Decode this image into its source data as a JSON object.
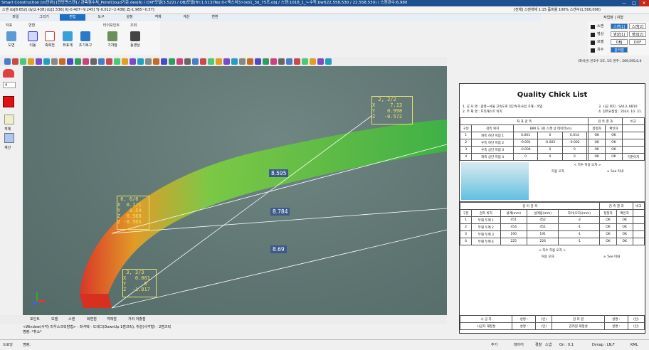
{
  "window": {
    "title": "Smart Construction [m단위] [전단면스캔] / 관측점수치_PointCloud기준.des(6) / DXF모델(3,522) / OBJ모델(Tri:1,513)Tex:0<텍스처3>)sb1_3d_75조.obj / 스캔:1018_1_ㄴ수득.bwf(22,558,530 / 22,558,530) / 스캔관수:6,980",
    "controls": [
      "—",
      "□",
      "✕"
    ]
  },
  "coords": "스캔 dx[8.652] dy[2.438] dz[2.536] X[-0.407~9.245] Y[-0.012~2.436] Z[-1.965~0.57]",
  "scale_info": "[전체] 스캔개체 1:15 줌비율 100% 스캔수(1,500,000)",
  "workmode": "작업창 | 지형",
  "menus": [
    "파일",
    "그리기",
    "편집",
    "도구",
    "설정",
    "객체",
    "계산",
    "변환"
  ],
  "active_menu": "편집",
  "ribbon": {
    "groups": [
      "작표",
      "변환",
      "타이포인트",
      "조회"
    ],
    "buttons": [
      "도면",
      "이동",
      "축회전",
      "좌표계",
      "초기복구",
      "기차참",
      "동영상"
    ]
  },
  "right_panel": {
    "rows": [
      {
        "label": "스캔",
        "b1": "스캔[1]",
        "b2": "스캔[2]"
      },
      {
        "label": "영상",
        "b1": "영상[1]",
        "b2": "영상[2]"
      },
      {
        "label": "모델",
        "b1": "OBJ",
        "b2": "DXF"
      },
      {
        "label": "치수",
        "b1": "관리점",
        "b2": ""
      }
    ],
    "caption": "(좌석선) 빈호수 5도, 5도 원주-, 569,595,0,0"
  },
  "annotations": [
    {
      "lines": "  2, 2/2\nX     7.13\nY    0.998\nZ   -0.572"
    },
    {
      "lines": " 6, 6/6\nX  0.1/1\nY   0.54\nZ  0.568\nZ -0.505"
    },
    {
      "lines": " 3, 3/3\nX   0.001\nY      0\nZ  -1.817"
    }
  ],
  "dimensions": [
    "8.595",
    "8.784",
    "8.69"
  ],
  "report": {
    "title": "Quality Chick List",
    "info_left": [
      "1. 공 사 명 : 광명~서울 고속도로 민간투자사업 기해 - 목업",
      "2. 부 재 명 : 프리캐스트 아치"
    ],
    "info_right": [
      "3. 시공 위치 : SA13, 6B10",
      "4. 검측요청일 : 2024. 10. 31."
    ],
    "t1": {
      "header": [
        "구분",
        "검측 위치",
        "허용 ±",
        "X",
        "Y",
        "Z",
        "정정자",
        "확인자",
        "비고"
      ],
      "group1": "좌 표 검 측",
      "group2": "검 측 결 과",
      "sub": "BIM 도 3D 스캔 상 데이터(m)",
      "rows": [
        [
          "1",
          "좌측 하단 지점 1",
          "0.001",
          "0",
          "0.014",
          "OK",
          "OK",
          ""
        ],
        [
          "2",
          "우측 하단 지점 2",
          "-0.001",
          "-0.002",
          "-0.002",
          "OK",
          "OK",
          ""
        ],
        [
          "3",
          "우측 상단 지점 3",
          "-0.004",
          "0",
          "0",
          "OK",
          "OK",
          ""
        ],
        [
          "4",
          "좌측 상단 지점 4",
          "0",
          "0",
          "0",
          "OK",
          "OK",
          "기준이치"
        ]
      ],
      "tolerance_title": "< 치수 허용 오차 >",
      "tolerance_label": "허용 오차",
      "tolerance_value": "± 5ee 이내"
    },
    "t2": {
      "group1": "길 이 검 측",
      "group2": "검 측 결 과",
      "header": [
        "구분",
        "검측 위치",
        "설계(mm)",
        "설계용(mm)",
        "차이(오차)(mm)",
        "정정자",
        "확인자",
        "비고"
      ],
      "rows": [
        [
          "1",
          "부재 두께 1",
          "451",
          "452",
          "-2",
          "OK",
          "OK"
        ],
        [
          "2",
          "부재 두께 2",
          "454",
          "451",
          "-1",
          "OK",
          "OK"
        ],
        [
          "3",
          "부재 두께 3",
          "190",
          "191",
          "-1",
          "OK",
          "OK"
        ],
        [
          "4",
          "부재 두께 4",
          "225",
          "226",
          "-1",
          "OK",
          "OK"
        ]
      ],
      "tolerance_title": "< 치수 허용 오차 >",
      "tolerance_label": "허용 오차",
      "tolerance_value": "± 5ee 이내"
    },
    "sign": [
      [
        "시  공  자",
        "성명 :",
        "(인)",
        "감  리  원",
        "성명 :",
        "(인)"
      ],
      [
        "시공자 재정성",
        "성명 :",
        "(인)",
        "감리원 재정성",
        "성명 :",
        "(인)"
      ]
    ]
  },
  "leftbar": {
    "number": "4",
    "labels": [
      "객체",
      "계산"
    ]
  },
  "bottombar": [
    "포인트",
    "모델",
    "스캔",
    "화면점",
    "객체점",
    "거리 저출점"
  ],
  "command": {
    "line1": "<Window(사각) 마우스크릭방법> - 좌석택 - 드래그(DownUp 1점크릭), 취성(사각형) - 2점크릭",
    "line2": "명령: *취소*",
    "prompt": "명령:"
  },
  "statusbar": {
    "mode": "드로잉",
    "right": [
      "추기",
      "레이어",
      "경찰",
      "스냅",
      "On : 0.1",
      "Dsnap : LN,F",
      "KML"
    ]
  }
}
